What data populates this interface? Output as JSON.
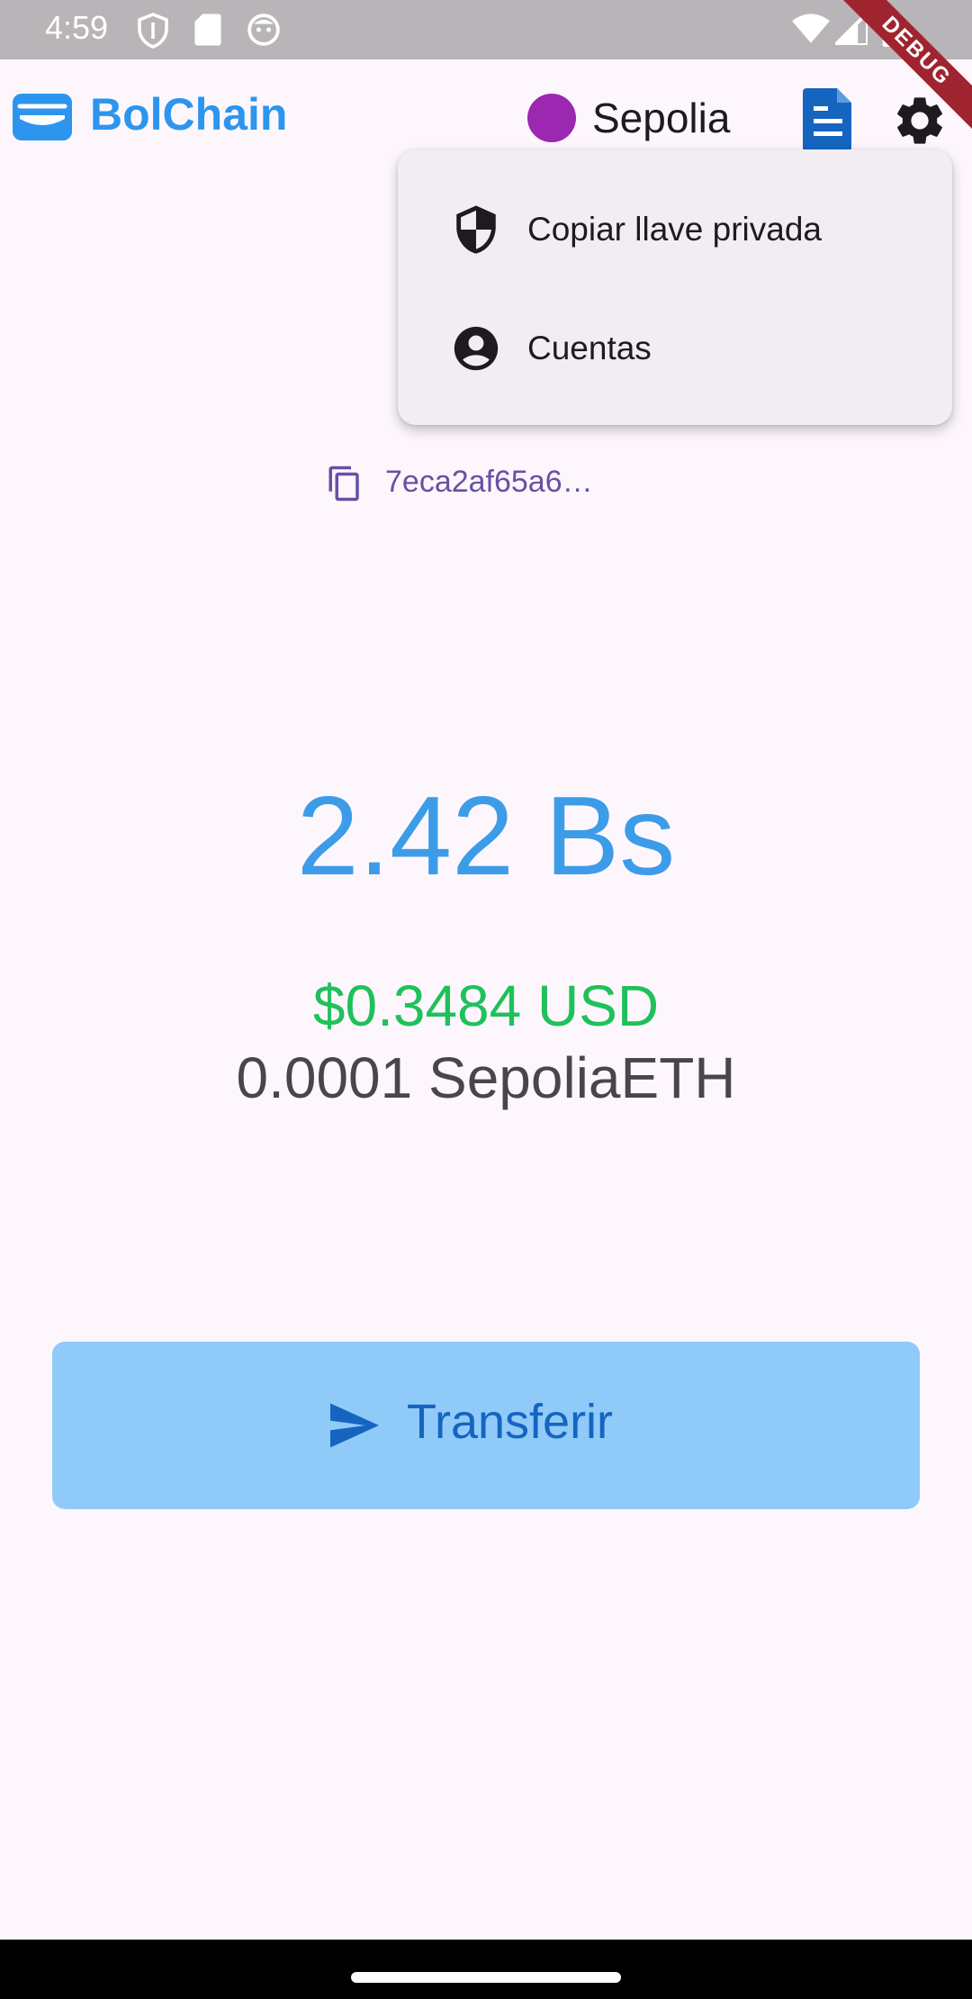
{
  "status_bar": {
    "time": "4:59",
    "left_icons": [
      "shield-icon",
      "sd-card-icon",
      "face-icon"
    ],
    "right_icons": [
      "wifi-icon",
      "signal-icon",
      "battery-icon"
    ]
  },
  "debug_banner": "DEBUG",
  "app_bar": {
    "title": "BolChain",
    "title_color": "#2d95ee",
    "network": {
      "label": "Sepolia",
      "dot_color": "#9c27b0"
    },
    "actions": [
      "document-icon",
      "gear-icon"
    ]
  },
  "menu": {
    "items": [
      {
        "label": "Copiar llave privada",
        "icon": "shield-icon"
      },
      {
        "label": "Cuentas",
        "icon": "account-circle-icon"
      }
    ]
  },
  "wallet": {
    "address_short": "7eca2af65a6…",
    "balance_main": "2.42 Bs",
    "balance_usd": "$0.3484 USD",
    "balance_eth": "0.0001 SepoliaETH",
    "colors": {
      "main": "#3d9ce8",
      "usd": "#1fc15a",
      "eth": "#49454f"
    }
  },
  "actions": {
    "transfer_label": "Transferir",
    "transfer_bg": "#90caf9"
  }
}
